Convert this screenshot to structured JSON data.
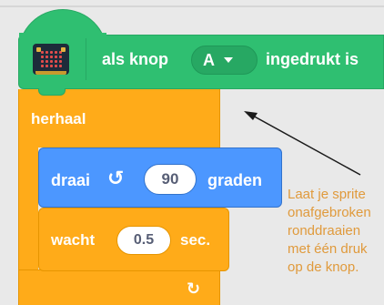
{
  "hat_block": {
    "extension_icon": "microbit-icon",
    "text_before": "als knop",
    "button_value": "A",
    "dropdown_icon": "triangle-down-icon",
    "text_after": "ingedrukt is"
  },
  "repeat_block": {
    "label": "herhaal",
    "loop_icon": "↻"
  },
  "turn_block": {
    "label": "draai",
    "direction_icon": "↺",
    "degrees": "90",
    "unit": "graden"
  },
  "wait_block": {
    "label": "wacht",
    "seconds": "0.5",
    "unit": "sec."
  },
  "annotation": {
    "lines": [
      "Laat je sprite",
      "onafgebroken",
      "ronddraaien",
      "met één druk",
      "op de knop."
    ]
  },
  "colors": {
    "events": "#2fbf71",
    "control": "#ffab19",
    "motion": "#4c97ff",
    "annotation": "#e09a3c"
  }
}
